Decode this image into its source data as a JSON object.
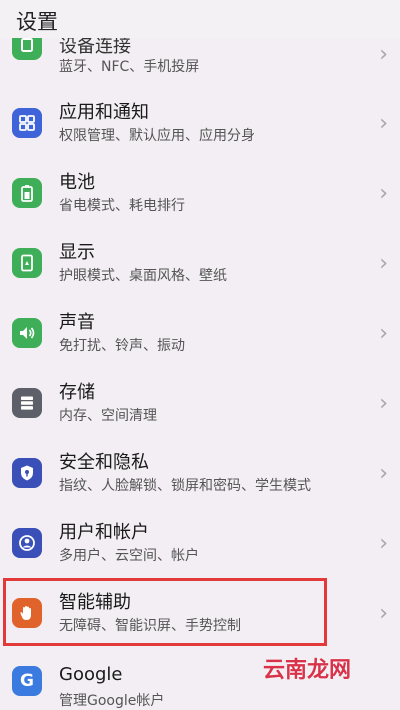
{
  "header": {
    "title": "设置"
  },
  "items": [
    {
      "title": "设备连接",
      "subtitle": "蓝牙、NFC、手机投屏",
      "icon": "device-connect-icon",
      "color": "#3fae59"
    },
    {
      "title": "应用和通知",
      "subtitle": "权限管理、默认应用、应用分身",
      "icon": "apps-icon",
      "color": "#3f63d8"
    },
    {
      "title": "电池",
      "subtitle": "省电模式、耗电排行",
      "icon": "battery-icon",
      "color": "#3fae59"
    },
    {
      "title": "显示",
      "subtitle": "护眼模式、桌面风格、壁纸",
      "icon": "display-icon",
      "color": "#3fae59"
    },
    {
      "title": "声音",
      "subtitle": "免打扰、铃声、振动",
      "icon": "sound-icon",
      "color": "#3fae59"
    },
    {
      "title": "存储",
      "subtitle": "内存、空间清理",
      "icon": "storage-icon",
      "color": "#5d6068"
    },
    {
      "title": "安全和隐私",
      "subtitle": "指纹、人脸解锁、锁屏和密码、学生模式",
      "icon": "shield-icon",
      "color": "#3b4fb8"
    },
    {
      "title": "用户和帐户",
      "subtitle": "多用户、云空间、帐户",
      "icon": "user-icon",
      "color": "#3b4fb8"
    },
    {
      "title": "智能辅助",
      "subtitle": "无障碍、智能识屏、手势控制",
      "icon": "hand-icon",
      "color": "#e0632b"
    },
    {
      "title": "Google",
      "subtitle": "管理Google帐户",
      "icon": "google-icon",
      "color": "#3b7be0"
    }
  ],
  "chevron": "›",
  "watermark": "云南龙网"
}
